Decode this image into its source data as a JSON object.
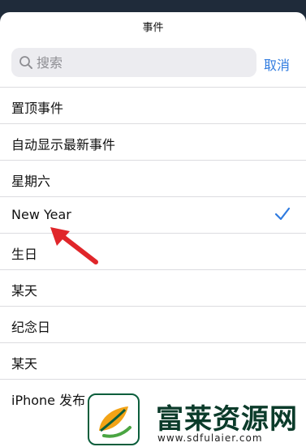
{
  "header": {
    "title": "事件"
  },
  "search": {
    "placeholder": "搜索",
    "cancel_label": "取消"
  },
  "list": {
    "items": [
      {
        "label": "置顶事件"
      },
      {
        "label": "自动显示最新事件"
      },
      {
        "label": "星期六"
      },
      {
        "label": "New Year",
        "selected": true
      },
      {
        "label": "生日"
      },
      {
        "label": "某天"
      },
      {
        "label": "纪念日"
      },
      {
        "label": "某天"
      },
      {
        "label": "iPhone 发布"
      }
    ]
  },
  "watermark": {
    "name": "富莱资源网",
    "url": "www.sdfulaier.com"
  },
  "colors": {
    "accent": "#2f7be0",
    "arrow": "#e0262a",
    "background": "#1f2b3a"
  },
  "icons": {
    "search": "search-icon",
    "check": "checkmark-icon",
    "annotation": "arrow-icon"
  }
}
